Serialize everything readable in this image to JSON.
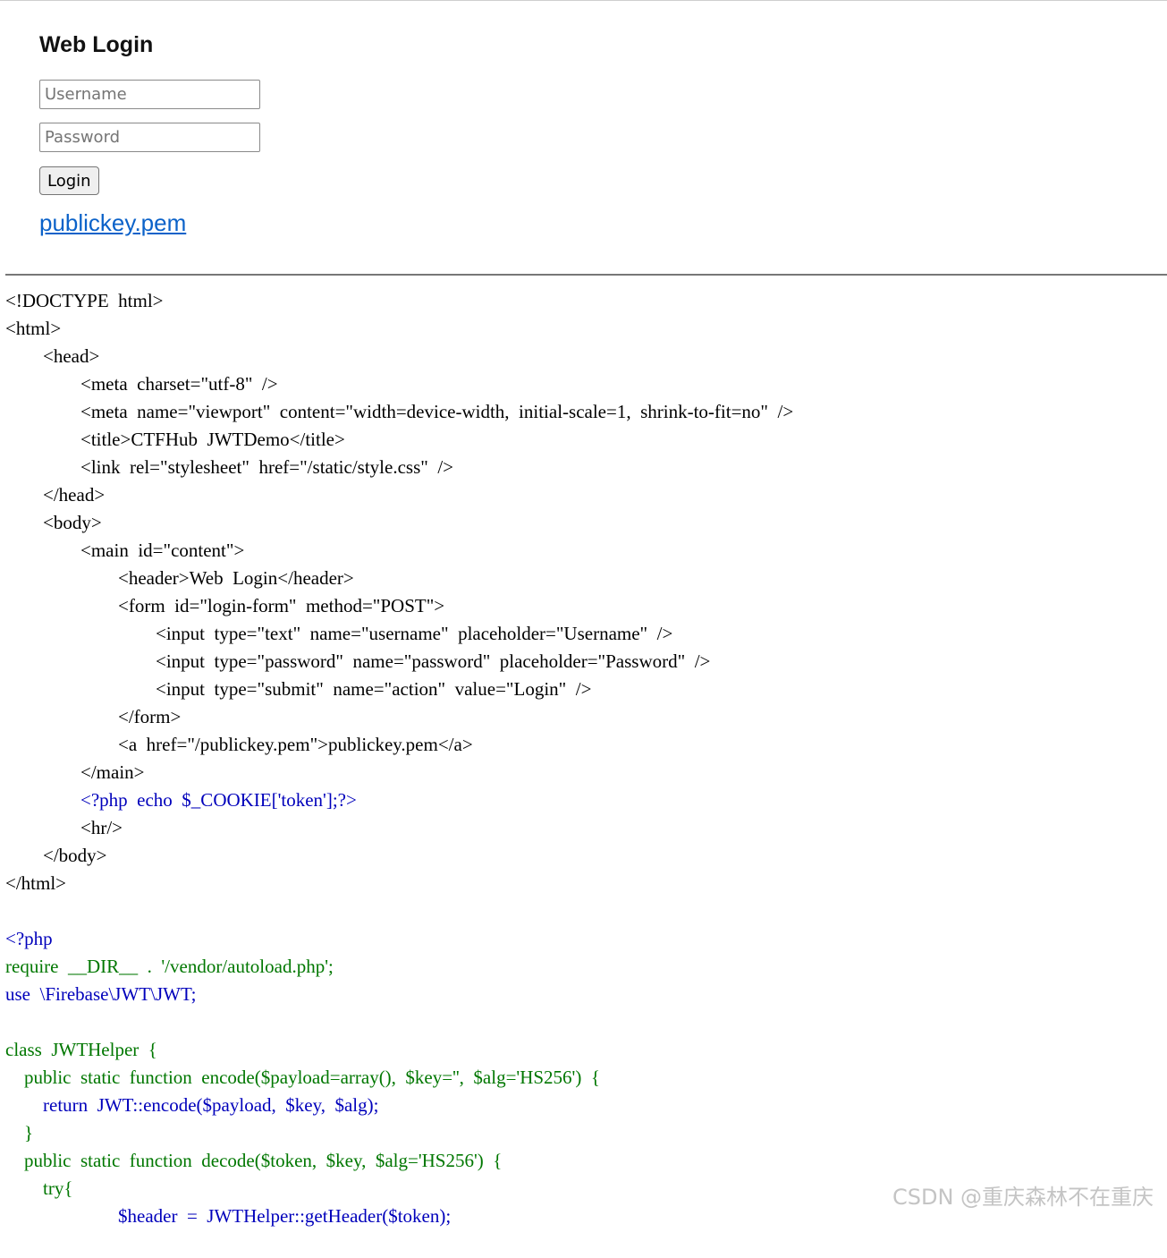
{
  "login": {
    "title": "Web Login",
    "username_placeholder": "Username",
    "password_placeholder": "Password",
    "button_label": "Login",
    "link_text": "publickey.pem"
  },
  "source_lines": [
    "<!DOCTYPE  html>",
    "<html>",
    "        <head>",
    "                <meta  charset=\"utf-8\"  />",
    "                <meta  name=\"viewport\"  content=\"width=device-width,  initial-scale=1,  shrink-to-fit=no\"  />",
    "                <title>CTFHub  JWTDemo</title>",
    "                <link  rel=\"stylesheet\"  href=\"/static/style.css\"  />",
    "        </head>",
    "        <body>",
    "                <main  id=\"content\">",
    "                        <header>Web  Login</header>",
    "                        <form  id=\"login-form\"  method=\"POST\">",
    "                                <input  type=\"text\"  name=\"username\"  placeholder=\"Username\"  />",
    "                                <input  type=\"password\"  name=\"password\"  placeholder=\"Password\"  />",
    "                                <input  type=\"submit\"  name=\"action\"  value=\"Login\"  />",
    "                        </form>",
    "                        <a  href=\"/publickey.pem\">publickey.pem</a>",
    "                </main>",
    "                <?php  echo  $_COOKIE['token'];?>",
    "                <hr/>",
    "        </body>",
    "</html>",
    "",
    "<?php",
    "require  __DIR__  .  '/vendor/autoload.php';",
    "use  \\Firebase\\JWT\\JWT;",
    "",
    "class  JWTHelper  {",
    "    public  static  function  encode($payload=array(),  $key='',  $alg='HS256')  {",
    "        return  JWT::encode($payload,  $key,  $alg);",
    "    }",
    "    public  static  function  decode($token,  $key,  $alg='HS256')  {",
    "        try{",
    "                        $header  =  JWTHelper::getHeader($token);"
  ],
  "watermark": "CSDN @重庆森林不在重庆"
}
